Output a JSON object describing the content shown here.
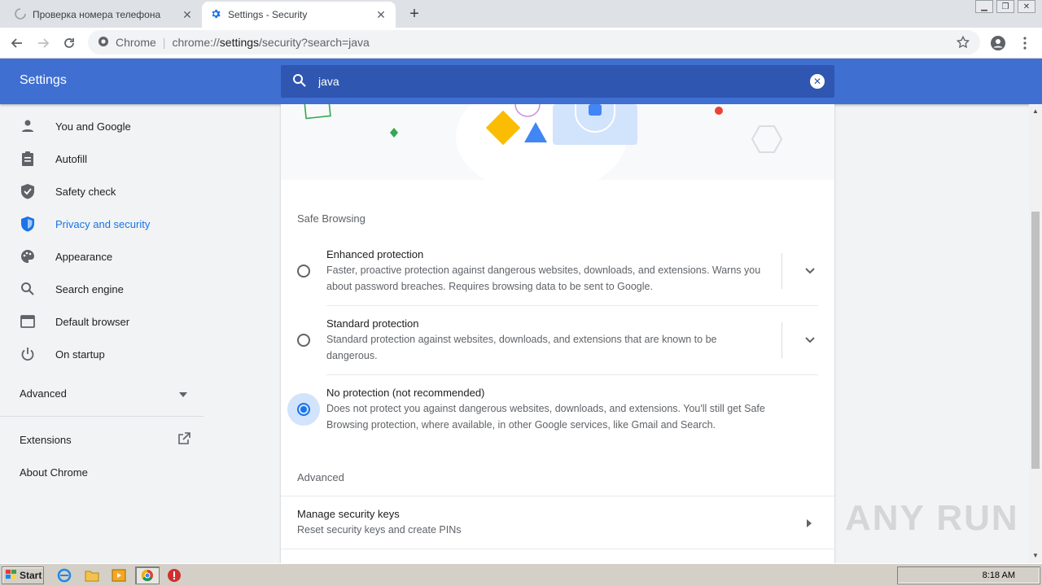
{
  "tabs": [
    {
      "title": "Проверка номера телефона",
      "active": false
    },
    {
      "title": "Settings - Security",
      "active": true
    }
  ],
  "toolbar": {
    "omnibox_chip": "Chrome",
    "url_scheme": "chrome://",
    "url_host": "settings",
    "url_rest": "/security?search=java"
  },
  "header": {
    "title": "Settings",
    "search_value": "java"
  },
  "sidebar": {
    "items": [
      {
        "label": "You and Google",
        "icon": "person-icon"
      },
      {
        "label": "Autofill",
        "icon": "clipboard-icon"
      },
      {
        "label": "Safety check",
        "icon": "shield-check-icon"
      },
      {
        "label": "Privacy and security",
        "icon": "shield-icon",
        "active": true
      },
      {
        "label": "Appearance",
        "icon": "palette-icon"
      },
      {
        "label": "Search engine",
        "icon": "search-icon"
      },
      {
        "label": "Default browser",
        "icon": "browser-icon"
      },
      {
        "label": "On startup",
        "icon": "power-icon"
      }
    ],
    "advanced": "Advanced",
    "extensions": "Extensions",
    "about": "About Chrome"
  },
  "main": {
    "safe_browsing_label": "Safe Browsing",
    "options": [
      {
        "title": "Enhanced protection",
        "desc": "Faster, proactive protection against dangerous websites, downloads, and extensions. Warns you about password breaches. Requires browsing data to be sent to Google.",
        "checked": false
      },
      {
        "title": "Standard protection",
        "desc": "Standard protection against websites, downloads, and extensions that are known to be dangerous.",
        "checked": false
      },
      {
        "title": "No protection (not recommended)",
        "desc": "Does not protect you against dangerous websites, downloads, and extensions. You'll still get Safe Browsing protection, where available, in other Google services, like Gmail and Search.",
        "checked": true
      }
    ],
    "advanced_label": "Advanced",
    "manage_keys_title": "Manage security keys",
    "manage_keys_sub": "Reset security keys and create PINs"
  },
  "watermark": "ANY RUN",
  "taskbar": {
    "start": "Start",
    "time": "8:18 AM"
  },
  "colors": {
    "header": "#3f6fd1",
    "accent": "#1a73e8"
  }
}
